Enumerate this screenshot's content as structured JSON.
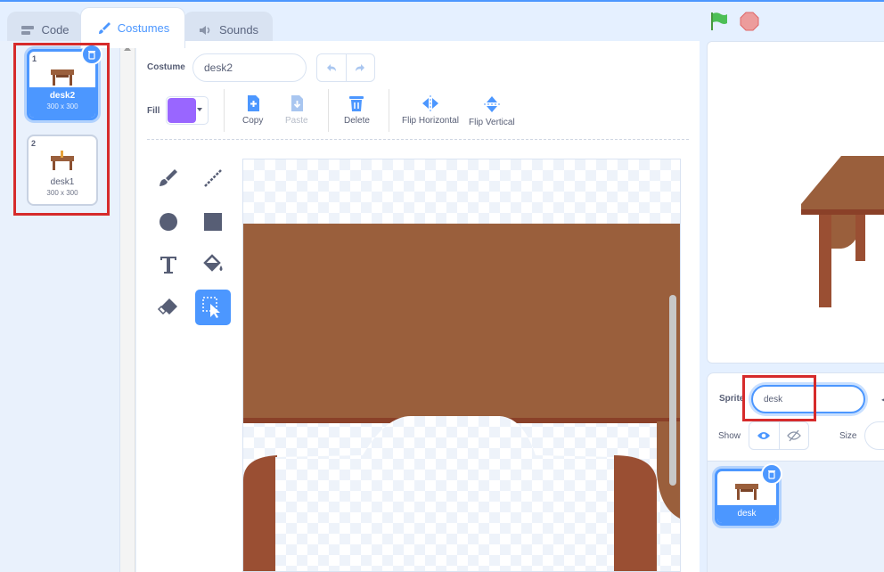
{
  "tabs": [
    {
      "label": "Code",
      "icon": "code-icon"
    },
    {
      "label": "Costumes",
      "icon": "paintbrush-icon"
    },
    {
      "label": "Sounds",
      "icon": "speaker-icon"
    }
  ],
  "costumes": [
    {
      "number": "1",
      "name": "desk2",
      "size": "300 x 300",
      "selected": true
    },
    {
      "number": "2",
      "name": "desk1",
      "size": "300 x 300",
      "selected": false
    }
  ],
  "editor": {
    "costume_label": "Costume",
    "costume_name": "desk2",
    "fill_label": "Fill",
    "fill_color": "#9966ff",
    "toolbar": {
      "copy": "Copy",
      "paste": "Paste",
      "delete": "Delete",
      "flip_horizontal": "Flip Horizontal",
      "flip_vertical": "Flip Vertical"
    },
    "tools": [
      "brush-icon",
      "line-icon",
      "circle-icon",
      "rectangle-icon",
      "text-icon",
      "fill-bucket-icon",
      "eraser-icon",
      "select-icon"
    ],
    "active_tool": "select-icon"
  },
  "stage_controls": {
    "green_flag": "green-flag-icon",
    "stop": "stop-icon"
  },
  "sprite_info": {
    "sprite_label": "Sprite",
    "sprite_name": "desk",
    "show_label": "Show",
    "size_label": "Size"
  },
  "sprites": [
    {
      "name": "desk",
      "selected": true
    }
  ],
  "colors": {
    "accent": "#4c97ff",
    "panel_bg": "#e9f1fc",
    "desk_brown": "#9a5f3c",
    "highlight_red": "#d62b2b"
  }
}
